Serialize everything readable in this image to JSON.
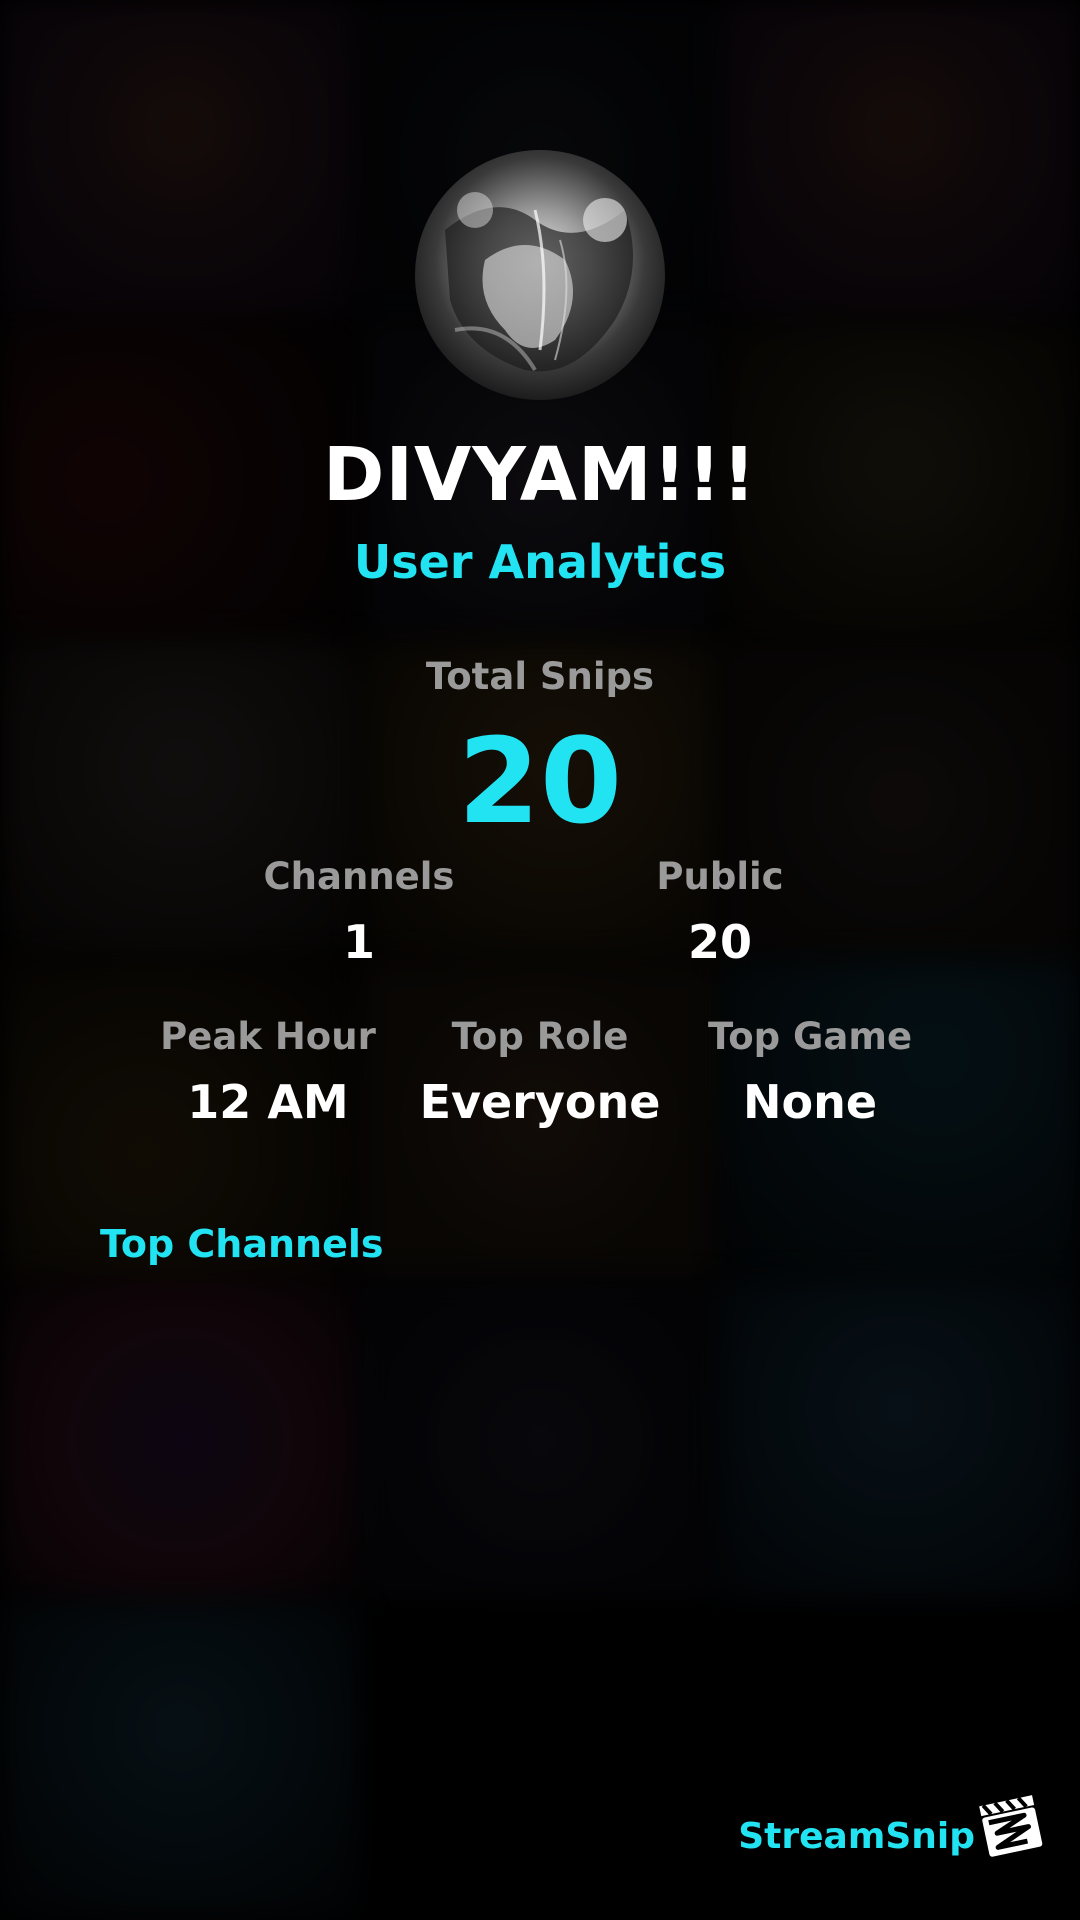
{
  "profile": {
    "username": "DIVYAM!!!",
    "subtitle": "User Analytics",
    "avatar_icon": "avatar-image"
  },
  "stats": {
    "total_snips": {
      "label": "Total Snips",
      "value": "20"
    },
    "channels": {
      "label": "Channels",
      "value": "1"
    },
    "public": {
      "label": "Public",
      "value": "20"
    },
    "peak_hour": {
      "label": "Peak Hour",
      "value": "12 AM"
    },
    "top_role": {
      "label": "Top Role",
      "value": "Everyone"
    },
    "top_game": {
      "label": "Top Game",
      "value": "None"
    }
  },
  "sections": {
    "top_channels_title": "Top Channels"
  },
  "brand": {
    "name": "StreamSnip",
    "logo_icon": "clapperboard-icon"
  },
  "colors": {
    "accent": "#22e3f2",
    "label_gray": "#9a9a9a",
    "value_white": "#ffffff",
    "background": "#000000"
  }
}
